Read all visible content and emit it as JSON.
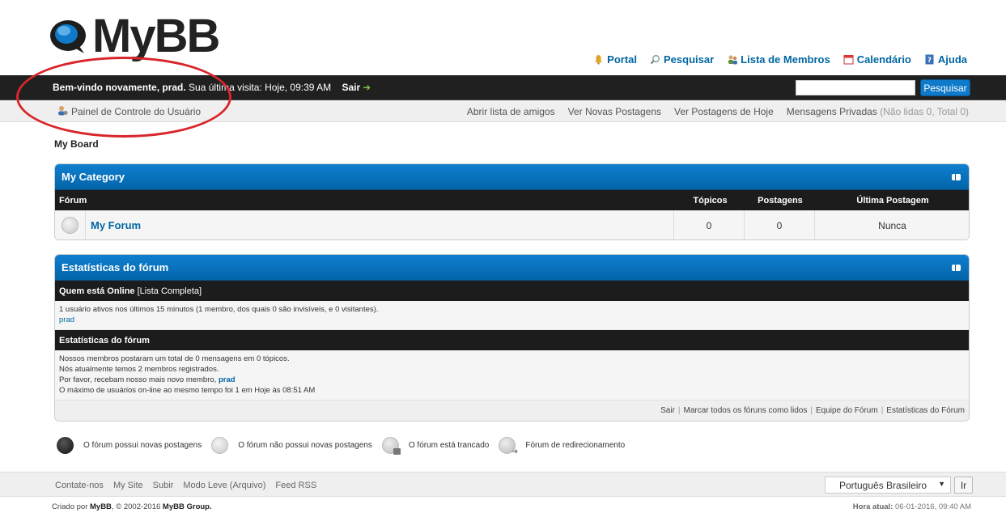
{
  "header": {
    "logo_text": "MyBB",
    "top_links": [
      {
        "label": "Portal",
        "icon": "bell-icon"
      },
      {
        "label": "Pesquisar",
        "icon": "magnifier-icon"
      },
      {
        "label": "Lista de Membros",
        "icon": "members-icon"
      },
      {
        "label": "Calendário",
        "icon": "calendar-icon"
      },
      {
        "label": "Ajuda",
        "icon": "help-icon"
      }
    ]
  },
  "welcome": {
    "greeting": "Bem-vindo novamente, prad.",
    "last_visit": "Sua última visita: Hoje, 09:39 AM",
    "logout": "Sair",
    "search_placeholder": "",
    "search_button": "Pesquisar"
  },
  "panel": {
    "ucp": "Painel de Controle do Usuário",
    "links": [
      "Abrir lista de amigos",
      "Ver Novas Postagens",
      "Ver Postagens de Hoje"
    ],
    "pm_label": "Mensagens Privadas",
    "pm_counts": "(Não lidas 0, Total 0)"
  },
  "breadcrumb": "My Board",
  "category": {
    "title": "My Category",
    "columns": {
      "forum": "Fórum",
      "topics": "Tópicos",
      "posts": "Postagens",
      "last_post": "Última Postagem"
    },
    "forums": [
      {
        "name": "My Forum",
        "topics": "0",
        "posts": "0",
        "last_post": "Nunca"
      }
    ]
  },
  "stats": {
    "title": "Estatísticas do fórum",
    "online_header": "Quem está Online",
    "online_link": "[Lista Completa]",
    "online_text": "1 usuário ativos nos últimos 15 minutos (1 membro, dos quais 0 são invisíveis, e 0 visitantes).",
    "online_users": "prad",
    "board_header": "Estatísticas do fórum",
    "line1": "Nossos membros postaram um total de 0 mensagens em 0 tópicos.",
    "line2": "Nós atualmente temos 2 membros registrados.",
    "line3_prefix": "Por favor, recebam nosso mais novo membro,",
    "line3_user": "prad",
    "line4": "O máximo de usuários on-line ao mesmo tempo foi 1 em Hoje às 08:51 AM",
    "footer_links": [
      "Sair",
      "Marcar todos os fóruns como lidos",
      "Equipe do Fórum",
      "Estatísticas do Fórum"
    ]
  },
  "legend": [
    {
      "label": "O fórum possui novas postagens",
      "icon": "new-posts-icon"
    },
    {
      "label": "O fórum não possui novas postagens",
      "icon": "no-new-posts-icon"
    },
    {
      "label": "O fórum está trancado",
      "icon": "locked-forum-icon"
    },
    {
      "label": "Fórum de redirecionamento",
      "icon": "redirect-forum-icon"
    }
  ],
  "footer": {
    "links": [
      "Contate-nos",
      "My Site",
      "Subir",
      "Modo Leve (Arquivo)",
      "Feed RSS"
    ],
    "language": "Português Brasileiro",
    "go_button": "Ir",
    "copyright_prefix": "Criado por",
    "copyright_brand": "MyBB",
    "copyright_mid": ", © 2002-2016",
    "copyright_group": "MyBB Group.",
    "time_label": "Hora atual:",
    "time_value": "06-01-2016, 09:40 AM"
  },
  "colors": {
    "accent": "#0f7ac9",
    "link": "#0066a2",
    "dark_bar": "#202020",
    "annotation": "#d9262c"
  }
}
